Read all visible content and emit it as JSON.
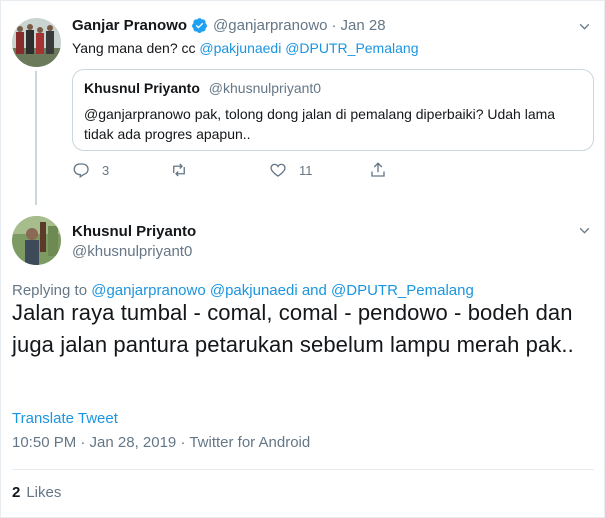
{
  "parent_tweet": {
    "name": "Ganjar Pranowo",
    "handle": "@ganjarpranowo",
    "separator": "·",
    "date": "Jan 28",
    "text_plain": "Yang mana den? cc ",
    "mention_1": "@pakjunaedi",
    "mention_2": "@DPUTR_Pemalang",
    "quote": {
      "name": "Khusnul Priyanto",
      "handle": "@khusnulpriyant0",
      "text": "@ganjarpranowo pak, tolong dong jalan di pemalang diperbaiki? Udah lama tidak ada progres apapun.."
    },
    "actions": {
      "reply_count": "3",
      "retweet_count": "",
      "like_count": "11"
    }
  },
  "main_tweet": {
    "name": "Khusnul Priyanto",
    "handle": "@khusnulpriyant0",
    "replying_prefix": "Replying to ",
    "reply_mention_1": "@ganjarpranowo",
    "reply_mention_2": "@pakjunaedi",
    "reply_and": " and ",
    "reply_mention_3": "@DPUTR_Pemalang",
    "text": "Jalan raya tumbal - comal, comal - pendowo - bodeh dan juga jalan pantura petarukan sebelum lampu merah pak..",
    "translate_label": "Translate Tweet",
    "meta": "10:50 PM · Jan 28, 2019 · Twitter for Android",
    "likes_count": "2",
    "likes_label": "Likes"
  },
  "colors": {
    "link": "#1b95e0",
    "secondary": "#657786",
    "verified": "#1da1f2"
  },
  "icons": [
    "verified-icon",
    "chevron-down-icon",
    "reply-icon",
    "retweet-icon",
    "like-icon",
    "share-icon"
  ]
}
